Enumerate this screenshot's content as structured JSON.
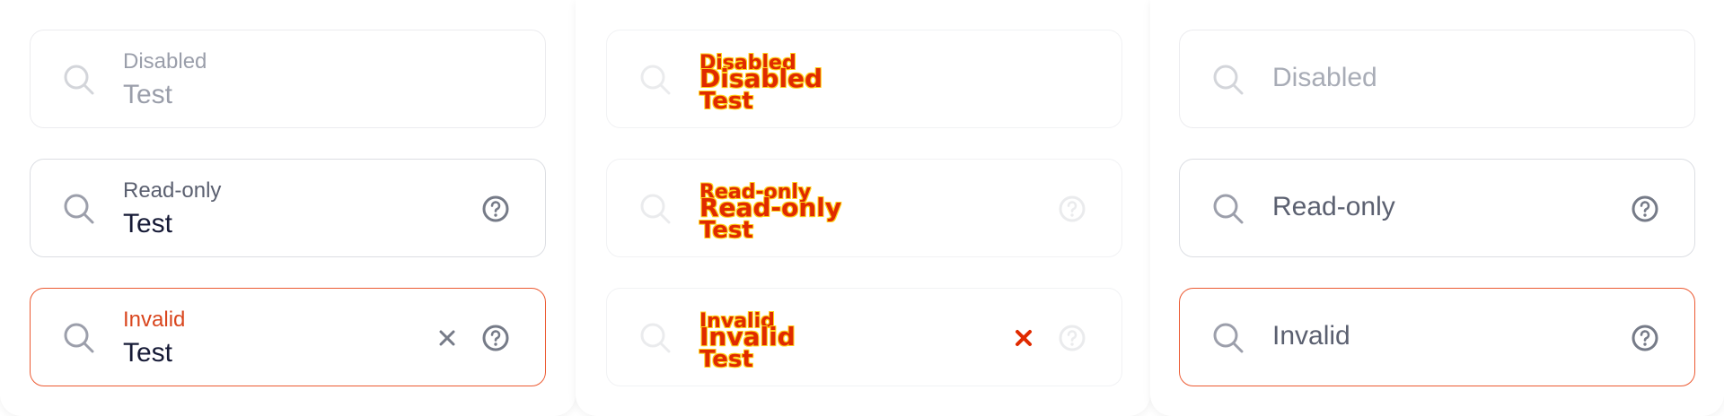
{
  "colors": {
    "border": "#dcdee3",
    "invalid_border": "#ec5a32",
    "invalid_label": "#d9461e",
    "text": "#161a36",
    "muted": "#5b6070",
    "debug_text": "#e02a00",
    "debug_outline": "#ffd21a"
  },
  "icons": {
    "leading": "search-icon",
    "help": "help-circle-icon",
    "clear": "close-icon"
  },
  "column_a": {
    "disabled": {
      "label": "Disabled",
      "value": "Test"
    },
    "readonly": {
      "label": "Read-only",
      "value": "Test"
    },
    "invalid": {
      "label": "Invalid",
      "value": "Test"
    }
  },
  "column_b": {
    "disabled": {
      "label_top": "Disabled",
      "label_mid": "Disabled",
      "value": "Test"
    },
    "readonly": {
      "label_top": "Read-only",
      "label_mid": "Read-only",
      "value": "Test"
    },
    "invalid": {
      "label_top": "Invalid",
      "label_mid": "Invalid",
      "value": "Test"
    }
  },
  "column_c": {
    "disabled": {
      "placeholder": "Disabled"
    },
    "readonly": {
      "placeholder": "Read-only"
    },
    "invalid": {
      "placeholder": "Invalid"
    }
  }
}
